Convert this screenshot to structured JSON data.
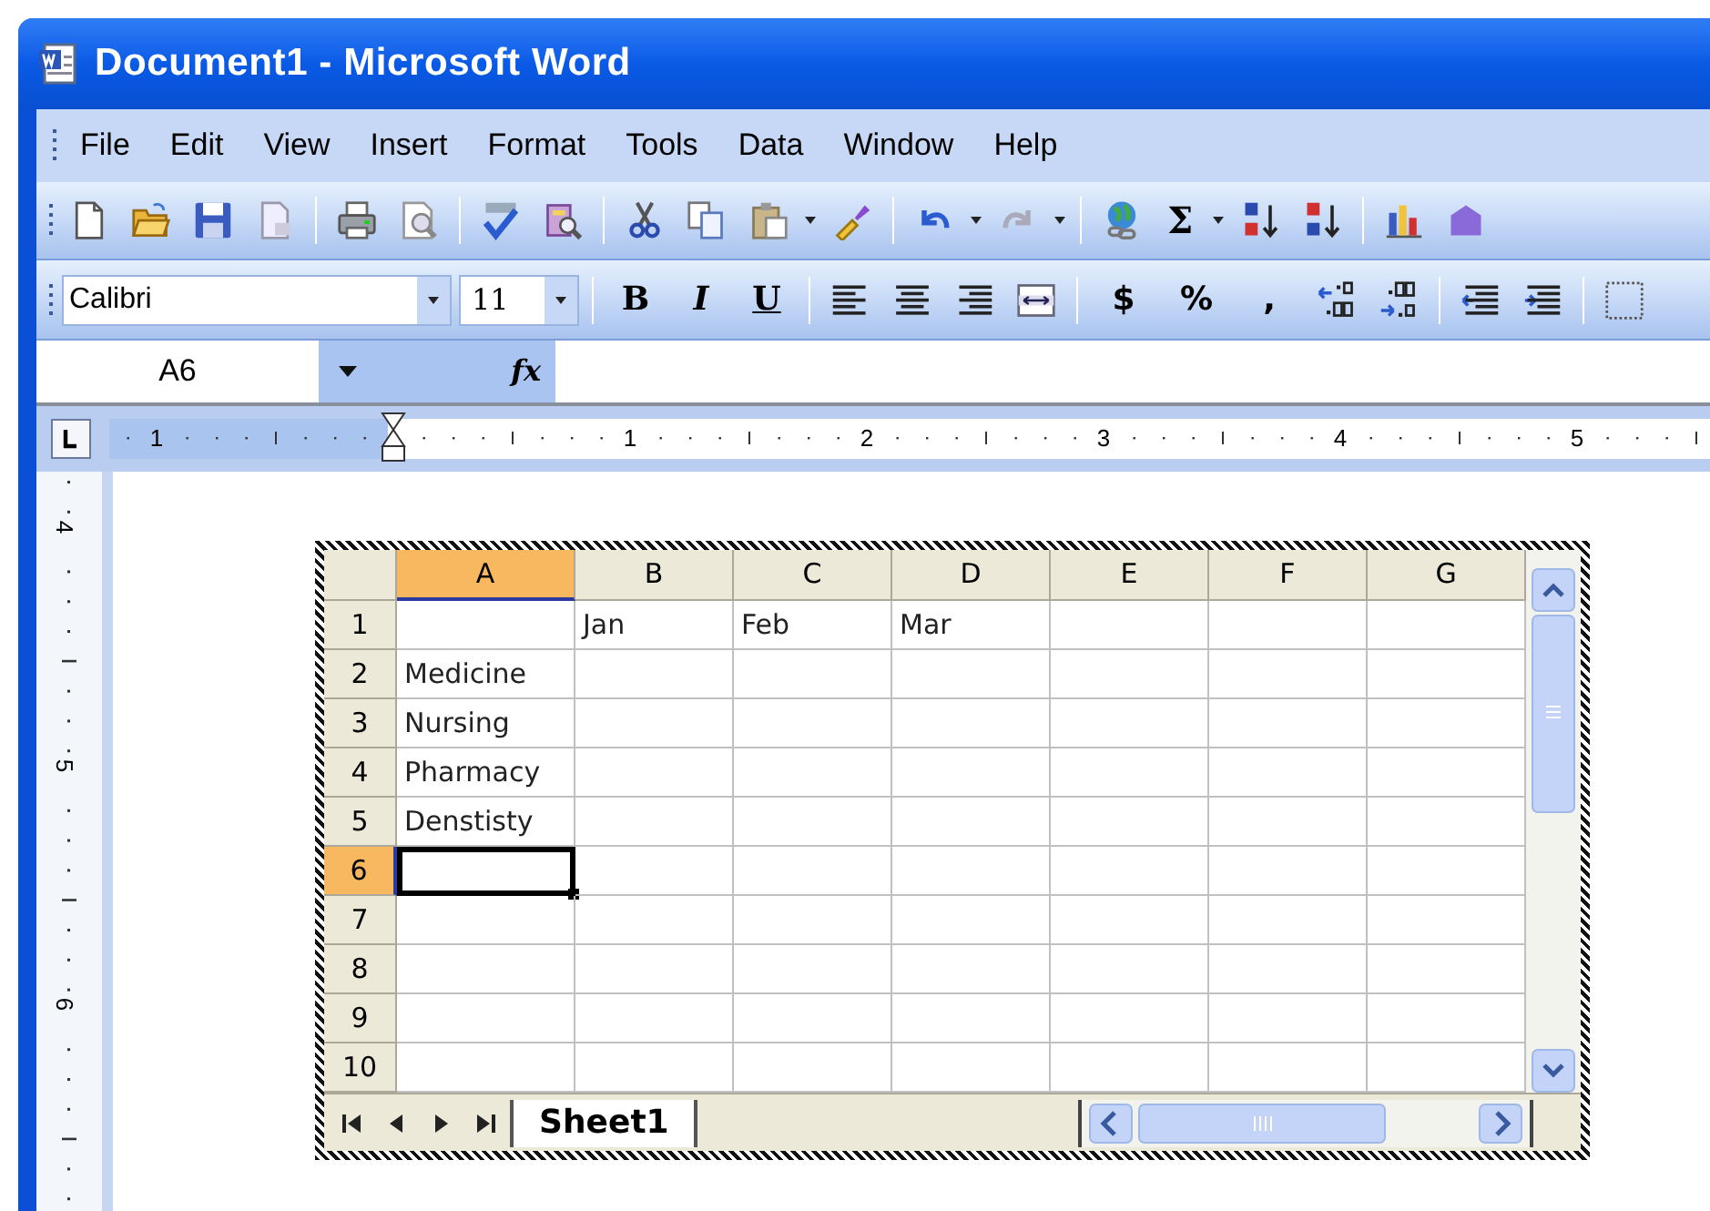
{
  "window": {
    "title": "Document1 - Microsoft Word"
  },
  "menu": [
    {
      "label": "File"
    },
    {
      "label": "Edit"
    },
    {
      "label": "View"
    },
    {
      "label": "Insert"
    },
    {
      "label": "Format"
    },
    {
      "label": "Tools"
    },
    {
      "label": "Data"
    },
    {
      "label": "Window"
    },
    {
      "label": "Help"
    }
  ],
  "standard_toolbar": {
    "autosum_label": "Σ"
  },
  "formatting_toolbar": {
    "font": "Calibri",
    "size": "11",
    "style_buttons": [
      "B",
      "I",
      "U"
    ],
    "number_buttons": [
      "$",
      "%",
      ","
    ]
  },
  "formula_bar": {
    "name_box": "A6",
    "function_label": "fx"
  },
  "horizontal_ruler": [
    "1",
    "1",
    "2",
    "3",
    "4",
    "5"
  ],
  "vertical_ruler": [
    "4",
    "5",
    "6"
  ],
  "sheet": {
    "columns": [
      {
        "label": "A",
        "selected": true
      },
      {
        "label": "B",
        "selected": false
      },
      {
        "label": "C",
        "selected": false
      },
      {
        "label": "D",
        "selected": false
      },
      {
        "label": "E",
        "selected": false
      },
      {
        "label": "F",
        "selected": false
      },
      {
        "label": "G",
        "selected": false
      }
    ],
    "rows": [
      {
        "label": "1",
        "selected": false,
        "cells": [
          null,
          "Jan",
          "Feb",
          "Mar",
          null,
          null,
          null
        ]
      },
      {
        "label": "2",
        "selected": false,
        "cells": [
          "Medicine",
          null,
          null,
          null,
          null,
          null,
          null
        ]
      },
      {
        "label": "3",
        "selected": false,
        "cells": [
          "Nursing",
          null,
          null,
          null,
          null,
          null,
          null
        ]
      },
      {
        "label": "4",
        "selected": false,
        "cells": [
          "Pharmacy",
          null,
          null,
          null,
          null,
          null,
          null
        ]
      },
      {
        "label": "5",
        "selected": false,
        "cells": [
          "Denstisty",
          null,
          null,
          null,
          null,
          null,
          null
        ]
      },
      {
        "label": "6",
        "selected": true
      },
      {
        "label": "7",
        "selected": false
      },
      {
        "label": "8",
        "selected": false
      },
      {
        "label": "9",
        "selected": false
      },
      {
        "label": "10",
        "selected": false
      }
    ],
    "tabs": [
      {
        "label": "Sheet1",
        "selected": true
      }
    ]
  }
}
